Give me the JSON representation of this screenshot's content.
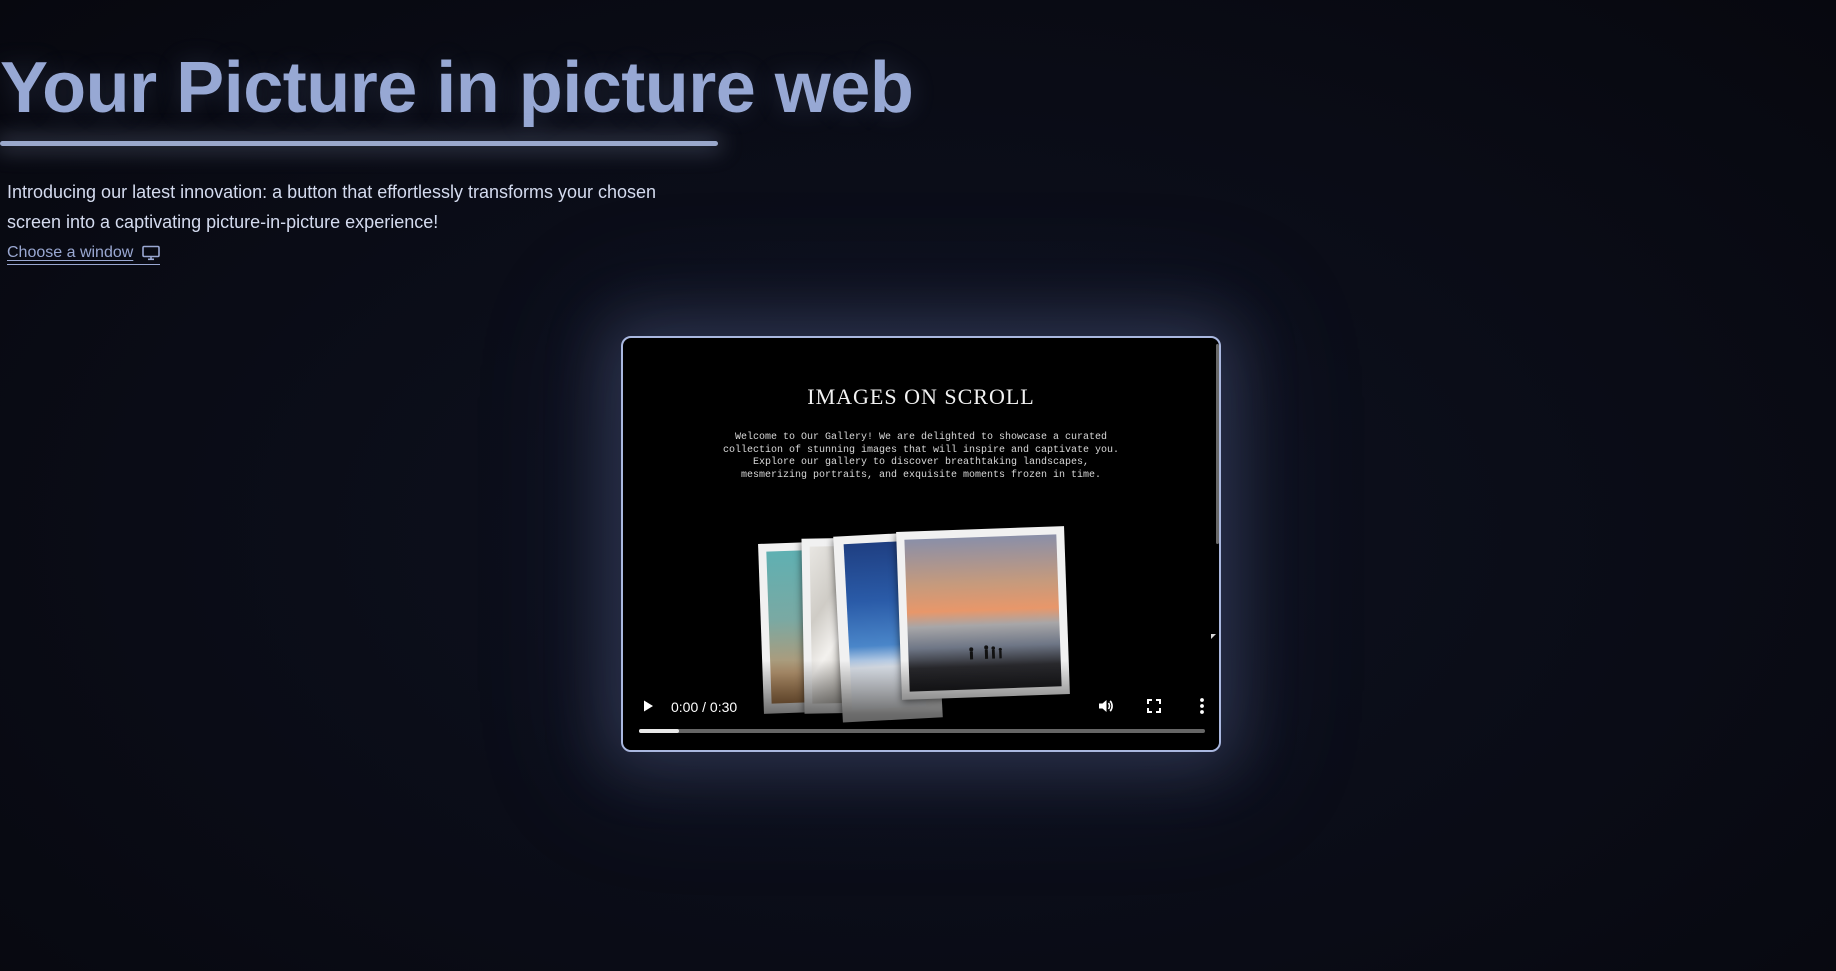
{
  "header": {
    "title": "Your Picture in picture web",
    "intro": "Introducing our latest innovation: a button that effortlessly transforms your chosen screen into a captivating picture-in-picture experience!",
    "choose_window_label": "Choose a window",
    "choose_window_icon": "monitor-icon"
  },
  "video": {
    "content": {
      "title": "IMAGES ON SCROLL",
      "description": "Welcome to Our Gallery! We are delighted to showcase a curated collection of stunning images that will inspire and captivate you. Explore our gallery to discover breathtaking landscapes, mesmerizing portraits, and exquisite moments frozen in time.",
      "photos": [
        "teal-photo",
        "marble-photo",
        "blue-sky-snow-photo",
        "sunset-beach-photo"
      ]
    },
    "controls": {
      "play_icon": "play-icon",
      "time": "0:00 / 0:30",
      "volume_icon": "volume-icon",
      "fullscreen_icon": "fullscreen-icon",
      "more_icon": "more-vertical-icon",
      "buffered_fraction": 0.07
    }
  },
  "colors": {
    "background": "#0b0d18",
    "title": "#97a8d4",
    "accent_border": "#aab8e0",
    "text": "#d4dbef",
    "link": "#9aa8d2"
  }
}
